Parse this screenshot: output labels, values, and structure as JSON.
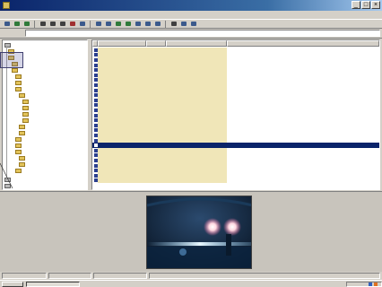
{
  "window": {
    "title": ""
  },
  "menu": {
    "items": [
      "",
      "",
      "",
      "",
      "",
      "",
      ""
    ]
  },
  "toolbar": {
    "tools": [
      "folder-up-icon",
      "back-icon",
      "forward-icon",
      "cut-icon",
      "copy-icon",
      "paste-icon",
      "delete-icon",
      "properties-icon",
      "view-icon",
      "slideshow-icon",
      "rotate-left-icon",
      "rotate-right-icon",
      "zoom-in-icon",
      "zoom-out-icon",
      "fit-icon",
      "print-icon",
      "email-icon",
      "help-icon"
    ]
  },
  "address": {
    "label": "",
    "value": ""
  },
  "tree": {
    "nodes": [
      {
        "label": "",
        "icon": "drive"
      },
      {
        "label": "",
        "icon": "folder"
      },
      {
        "label": "",
        "icon": "folder"
      },
      {
        "label": "",
        "icon": "folder"
      },
      {
        "label": "",
        "icon": "folder"
      },
      {
        "label": "",
        "icon": "folder"
      },
      {
        "label": "",
        "icon": "folder"
      },
      {
        "label": "",
        "icon": "folder"
      },
      {
        "label": "",
        "icon": "folder"
      },
      {
        "label": "",
        "icon": "folder"
      },
      {
        "label": "",
        "icon": "folder"
      },
      {
        "label": "",
        "icon": "folder"
      },
      {
        "label": "",
        "icon": "folder"
      },
      {
        "label": "",
        "icon": "folder"
      },
      {
        "label": "",
        "icon": "folder"
      },
      {
        "label": "",
        "icon": "folder"
      },
      {
        "label": "",
        "icon": "folder"
      },
      {
        "label": "",
        "icon": "folder"
      },
      {
        "label": "",
        "icon": "folder"
      },
      {
        "label": "",
        "icon": "folder"
      },
      {
        "label": "",
        "icon": "folder"
      },
      {
        "label": "",
        "icon": "drive"
      },
      {
        "label": "",
        "icon": "drive"
      }
    ]
  },
  "list": {
    "columns": [
      "",
      "",
      "",
      ""
    ],
    "rows": [
      {
        "name": "",
        "size": "",
        "type": "",
        "selected": false
      },
      {
        "name": "",
        "size": "",
        "type": "",
        "selected": false
      },
      {
        "name": "",
        "size": "",
        "type": "",
        "selected": false
      },
      {
        "name": "",
        "size": "",
        "type": "",
        "selected": false
      },
      {
        "name": "",
        "size": "",
        "type": "",
        "selected": false
      },
      {
        "name": "",
        "size": "",
        "type": "",
        "selected": false
      },
      {
        "name": "",
        "size": "",
        "type": "",
        "selected": false
      },
      {
        "name": "",
        "size": "",
        "type": "",
        "selected": false
      },
      {
        "name": "",
        "size": "",
        "type": "",
        "selected": false
      },
      {
        "name": "",
        "size": "",
        "type": "",
        "selected": false
      },
      {
        "name": "",
        "size": "",
        "type": "",
        "selected": false
      },
      {
        "name": "",
        "size": "",
        "type": "",
        "selected": false
      },
      {
        "name": "",
        "size": "",
        "type": "",
        "selected": false
      },
      {
        "name": "",
        "size": "",
        "type": "",
        "selected": false
      },
      {
        "name": "",
        "size": "",
        "type": "",
        "selected": false
      },
      {
        "name": "",
        "size": "",
        "type": "",
        "selected": false
      },
      {
        "name": "",
        "size": "",
        "type": "",
        "selected": false
      },
      {
        "name": "",
        "size": "",
        "type": "",
        "selected": false
      },
      {
        "name": "",
        "size": "",
        "type": "",
        "selected": false
      },
      {
        "name": "",
        "size": "",
        "type": "",
        "selected": true
      },
      {
        "name": "",
        "size": "",
        "type": "",
        "selected": false
      },
      {
        "name": "",
        "size": "",
        "type": "",
        "selected": false
      },
      {
        "name": "",
        "size": "",
        "type": "",
        "selected": false
      },
      {
        "name": "",
        "size": "",
        "type": "",
        "selected": false
      },
      {
        "name": "",
        "size": "",
        "type": "",
        "selected": false
      },
      {
        "name": "",
        "size": "",
        "type": "",
        "selected": false
      },
      {
        "name": "",
        "size": "",
        "type": "",
        "selected": false
      }
    ]
  },
  "preview": {
    "icon": "image-thumbnail"
  },
  "status": {
    "cells": [
      "",
      "",
      "",
      ""
    ]
  },
  "taskbar": {
    "start_label": "",
    "task_label": "",
    "clock": ""
  },
  "colors": {
    "selection": "#0a246a",
    "highlight": "#f0e6b8",
    "titlebar": "#0a246a"
  }
}
